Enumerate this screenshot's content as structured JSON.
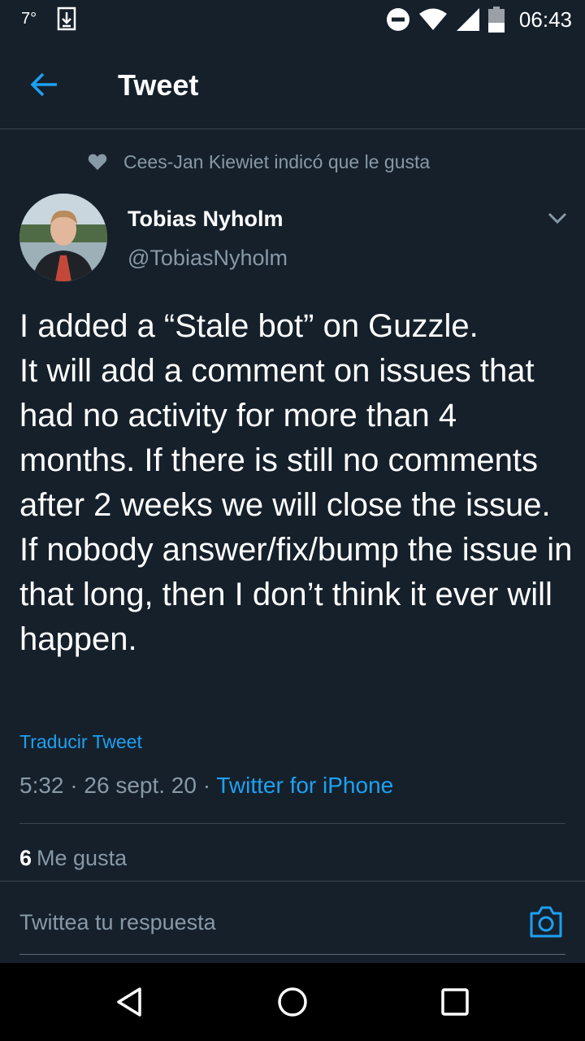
{
  "status_bar": {
    "temperature": "7°",
    "time": "06:43",
    "icons": [
      "download-notification-icon",
      "do-not-disturb-icon",
      "wifi-icon",
      "signal-icon",
      "battery-icon"
    ]
  },
  "header": {
    "back_icon": "arrow-left-icon",
    "title": "Tweet"
  },
  "social_context": {
    "icon": "heart-icon",
    "text": "Cees-Jan Kiewiet indicó que le gusta"
  },
  "author": {
    "name": "Tobias Nyholm",
    "handle": "@TobiasNyholm"
  },
  "tweet": {
    "text": "I added a “Stale bot” on Guzzle.\nIt will add a comment on issues that had no activity for more than 4 months. If there is still no comments after 2 weeks we will close the issue.\nIf nobody answer/fix/bump the issue in that long, then I don’t think it ever will happen.",
    "translate_label": "Traducir Tweet",
    "time": "5:32",
    "sep1": " · ",
    "date": "26 sept. 20",
    "sep2": " · ",
    "client": "Twitter for iPhone"
  },
  "stats": {
    "likes_count": "6",
    "likes_label": "Me gusta"
  },
  "reply": {
    "placeholder": "Twittea tu respuesta",
    "camera_icon": "camera-icon"
  },
  "nav_bar": {
    "icons": [
      "nav-back-icon",
      "nav-home-icon",
      "nav-recents-icon"
    ]
  },
  "colors": {
    "background": "#15202b",
    "accent": "#1da1f2",
    "secondary_text": "#8899a6",
    "divider": "#38444d"
  }
}
